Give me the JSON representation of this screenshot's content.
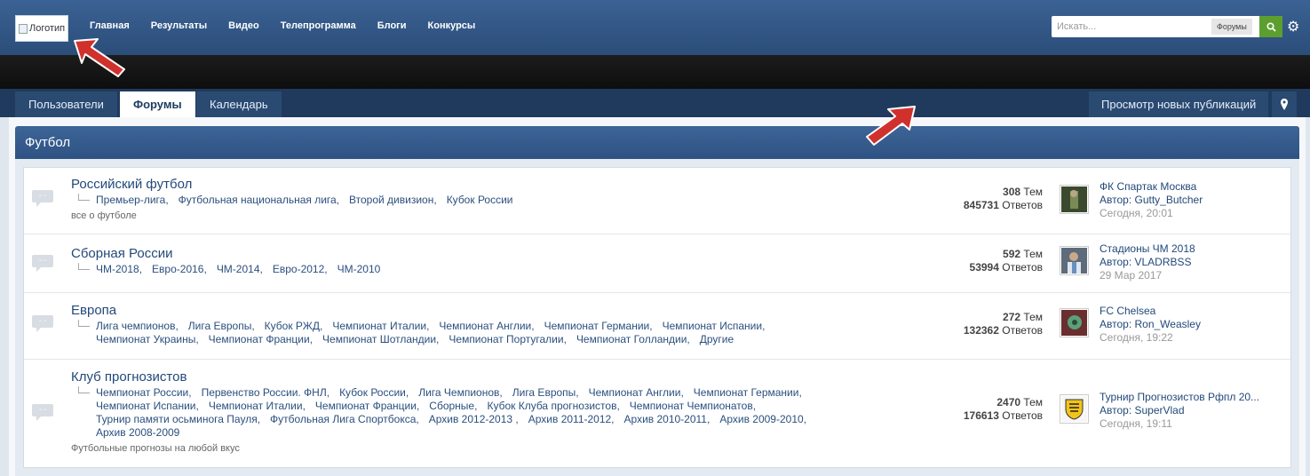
{
  "header": {
    "logo_alt": "Логотип",
    "nav": [
      "Главная",
      "Результаты",
      "Видео",
      "Телепрограмма",
      "Блоги",
      "Конкурсы"
    ],
    "search_placeholder": "Искать...",
    "search_scope": "Форумы"
  },
  "tabs": {
    "items": [
      "Пользователи",
      "Форумы",
      "Календарь"
    ],
    "active": "Форумы",
    "new_posts": "Просмотр новых публикаций"
  },
  "section_title": "Футбол",
  "forums": [
    {
      "name": "Российский футбол",
      "subforums": [
        "Премьер-лига,",
        "Футбольная национальная лига,",
        "Второй дивизион,",
        "Кубок России"
      ],
      "description": "все о футболе",
      "topics": "308",
      "topics_label": "Тем",
      "replies": "845731",
      "replies_label": "Ответов",
      "last_title": "ФК Спартак Москва",
      "last_author": "Автор: Gutty_Butcher",
      "last_date": "Сегодня, 20:01"
    },
    {
      "name": "Сборная России",
      "subforums": [
        "ЧМ-2018,",
        "Евро-2016,",
        "ЧМ-2014,",
        "Евро-2012,",
        "ЧМ-2010"
      ],
      "description": "",
      "topics": "592",
      "topics_label": "Тем",
      "replies": "53994",
      "replies_label": "Ответов",
      "last_title": "Стадионы ЧМ 2018",
      "last_author": "Автор: VLADRBSS",
      "last_date": "29 Мар 2017"
    },
    {
      "name": "Европа",
      "subforums": [
        "Лига чемпионов,",
        "Лига Европы,",
        "Кубок РЖД,",
        "Чемпионат Италии,",
        "Чемпионат Англии,",
        "Чемпионат Германии,",
        "Чемпионат Испании,",
        "Чемпионат Украины,",
        "Чемпионат Франции,",
        "Чемпионат Шотландии,",
        "Чемпионат Португалии,",
        "Чемпионат Голландии,",
        "Другие"
      ],
      "description": "",
      "topics": "272",
      "topics_label": "Тем",
      "replies": "132362",
      "replies_label": "Ответов",
      "last_title": "FC Chelsea",
      "last_author": "Автор: Ron_Weasley",
      "last_date": "Сегодня, 19:22"
    },
    {
      "name": "Клуб прогнозистов",
      "subforums": [
        "Чемпионат России,",
        "Первенство России. ФНЛ,",
        "Кубок России,",
        "Лига Чемпионов,",
        "Лига Европы,",
        "Чемпионат Англии,",
        "Чемпионат Германии,",
        "Чемпионат Испании,",
        "Чемпионат Италии,",
        "Чемпионат Франции,",
        "Сборные,",
        "Кубок Клуба прогнозистов,",
        "Чемпионат Чемпионатов,",
        "Турнир памяти осьминога Пауля,",
        "Футбольная Лига Спортбокса,",
        "Архив 2012-2013 ,",
        "Архив 2011-2012,",
        "Архив 2010-2011,",
        "Архив 2009-2010,",
        "Архив 2008-2009"
      ],
      "description": "Футбольные прогнозы на любой вкус",
      "topics": "2470",
      "topics_label": "Тем",
      "replies": "176613",
      "replies_label": "Ответов",
      "last_title": "Турнир Прогнозистов Рфпл 20...",
      "last_author": "Автор: SuperVlad",
      "last_date": "Сегодня, 19:11"
    }
  ],
  "colors": {
    "header": "#2f5384",
    "accent_green": "#5c9f2f",
    "link": "#23497a",
    "arrow": "#d0312d"
  }
}
